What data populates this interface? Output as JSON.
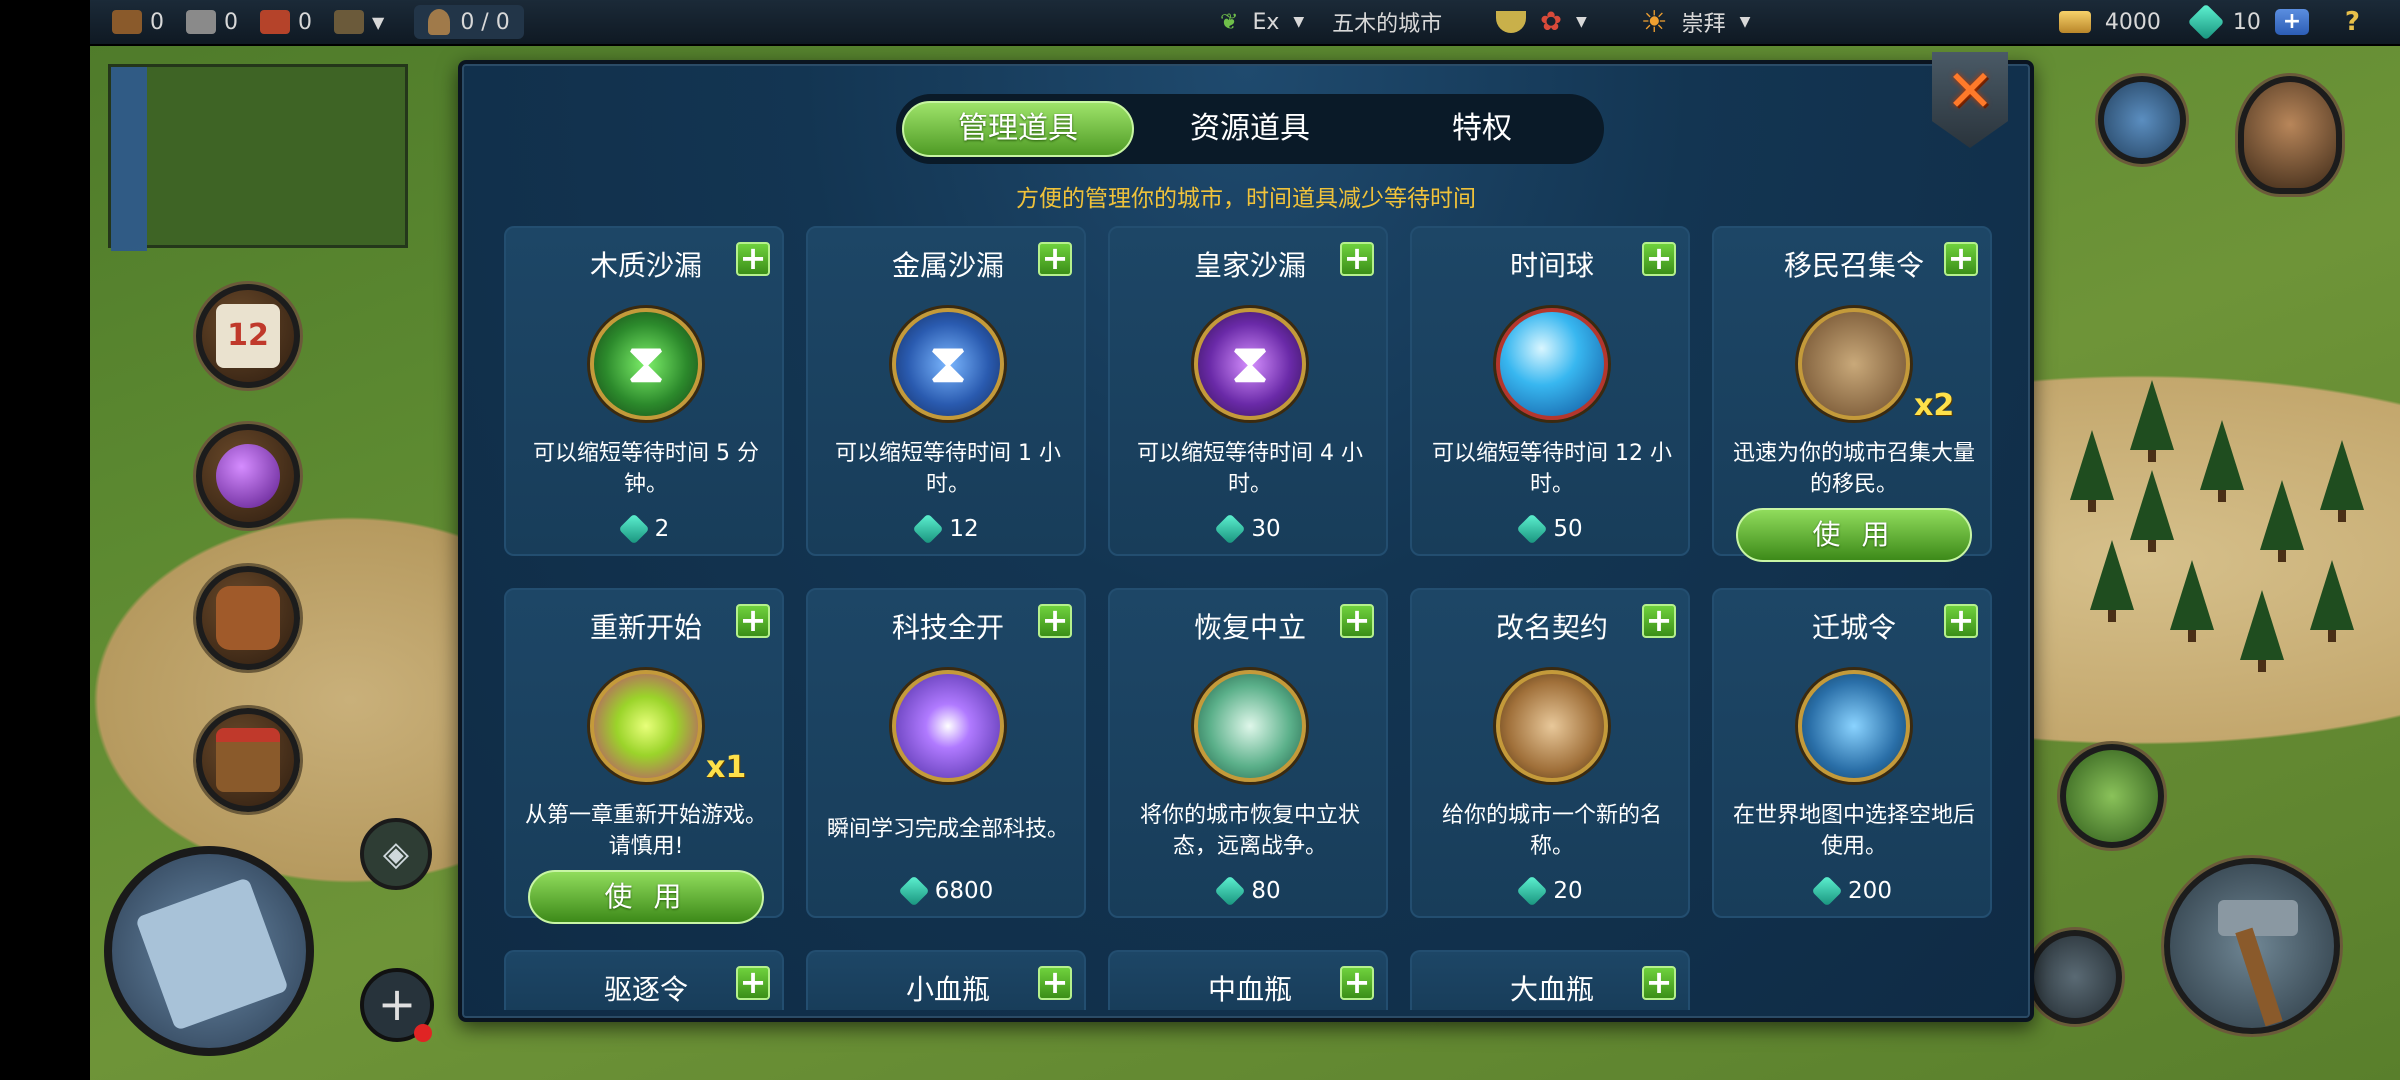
{
  "topbar": {
    "resources": [
      {
        "icon": "wood-icon",
        "value": "0",
        "color": "#8a5a2b"
      },
      {
        "icon": "stone-icon",
        "value": "0",
        "color": "#8a8a8a"
      },
      {
        "icon": "brick-icon",
        "value": "0",
        "color": "#b5432a"
      }
    ],
    "population": "0 / 0",
    "city_level": "Ex",
    "city_name": "五木的城市",
    "worship": "崇拜",
    "gold": "4000",
    "gems": "10",
    "plus_label": "+",
    "help_label": "?"
  },
  "hud": {
    "calendar_number": "12",
    "add_label": "+"
  },
  "dialog": {
    "close_label": "✕",
    "tabs": [
      {
        "label": "管理道具",
        "active": true
      },
      {
        "label": "资源道具",
        "active": false
      },
      {
        "label": "特权",
        "active": false
      }
    ],
    "subtitle": "方便的管理你的城市，时间道具减少等待时间",
    "plus_label": "+",
    "items": [
      {
        "title": "木质沙漏",
        "icon": "wooden-hourglass-icon",
        "desc": "可以缩短等待时间 5 分钟。",
        "price": "2"
      },
      {
        "title": "金属沙漏",
        "icon": "metal-hourglass-icon",
        "desc": "可以缩短等待时间 1 小时。",
        "price": "12"
      },
      {
        "title": "皇家沙漏",
        "icon": "royal-hourglass-icon",
        "desc": "可以缩短等待时间 4 小时。",
        "price": "30"
      },
      {
        "title": "时间球",
        "icon": "time-orb-icon",
        "desc": "可以缩短等待时间 12 小时。",
        "price": "50"
      },
      {
        "title": "移民召集令",
        "icon": "settlers-icon",
        "desc": "迅速为你的城市召集大量的移民。",
        "count": "x2",
        "button": "使 用"
      },
      {
        "title": "重新开始",
        "icon": "restart-icon",
        "desc": "从第一章重新开始游戏。请慎用!",
        "count": "x1",
        "button": "使 用"
      },
      {
        "title": "科技全开",
        "icon": "tech-unlock-icon",
        "desc": "瞬间学习完成全部科技。",
        "price": "6800"
      },
      {
        "title": "恢复中立",
        "icon": "dove-icon",
        "desc": "将你的城市恢复中立状态，远离战争。",
        "price": "80"
      },
      {
        "title": "改名契约",
        "icon": "rename-scroll-icon",
        "desc": "给你的城市一个新的名称。",
        "price": "20"
      },
      {
        "title": "迁城令",
        "icon": "wagon-icon",
        "desc": "在世界地图中选择空地后使用。",
        "price": "200"
      },
      {
        "title": "驱逐令"
      },
      {
        "title": "小血瓶"
      },
      {
        "title": "中血瓶"
      },
      {
        "title": "大血瓶"
      }
    ]
  }
}
